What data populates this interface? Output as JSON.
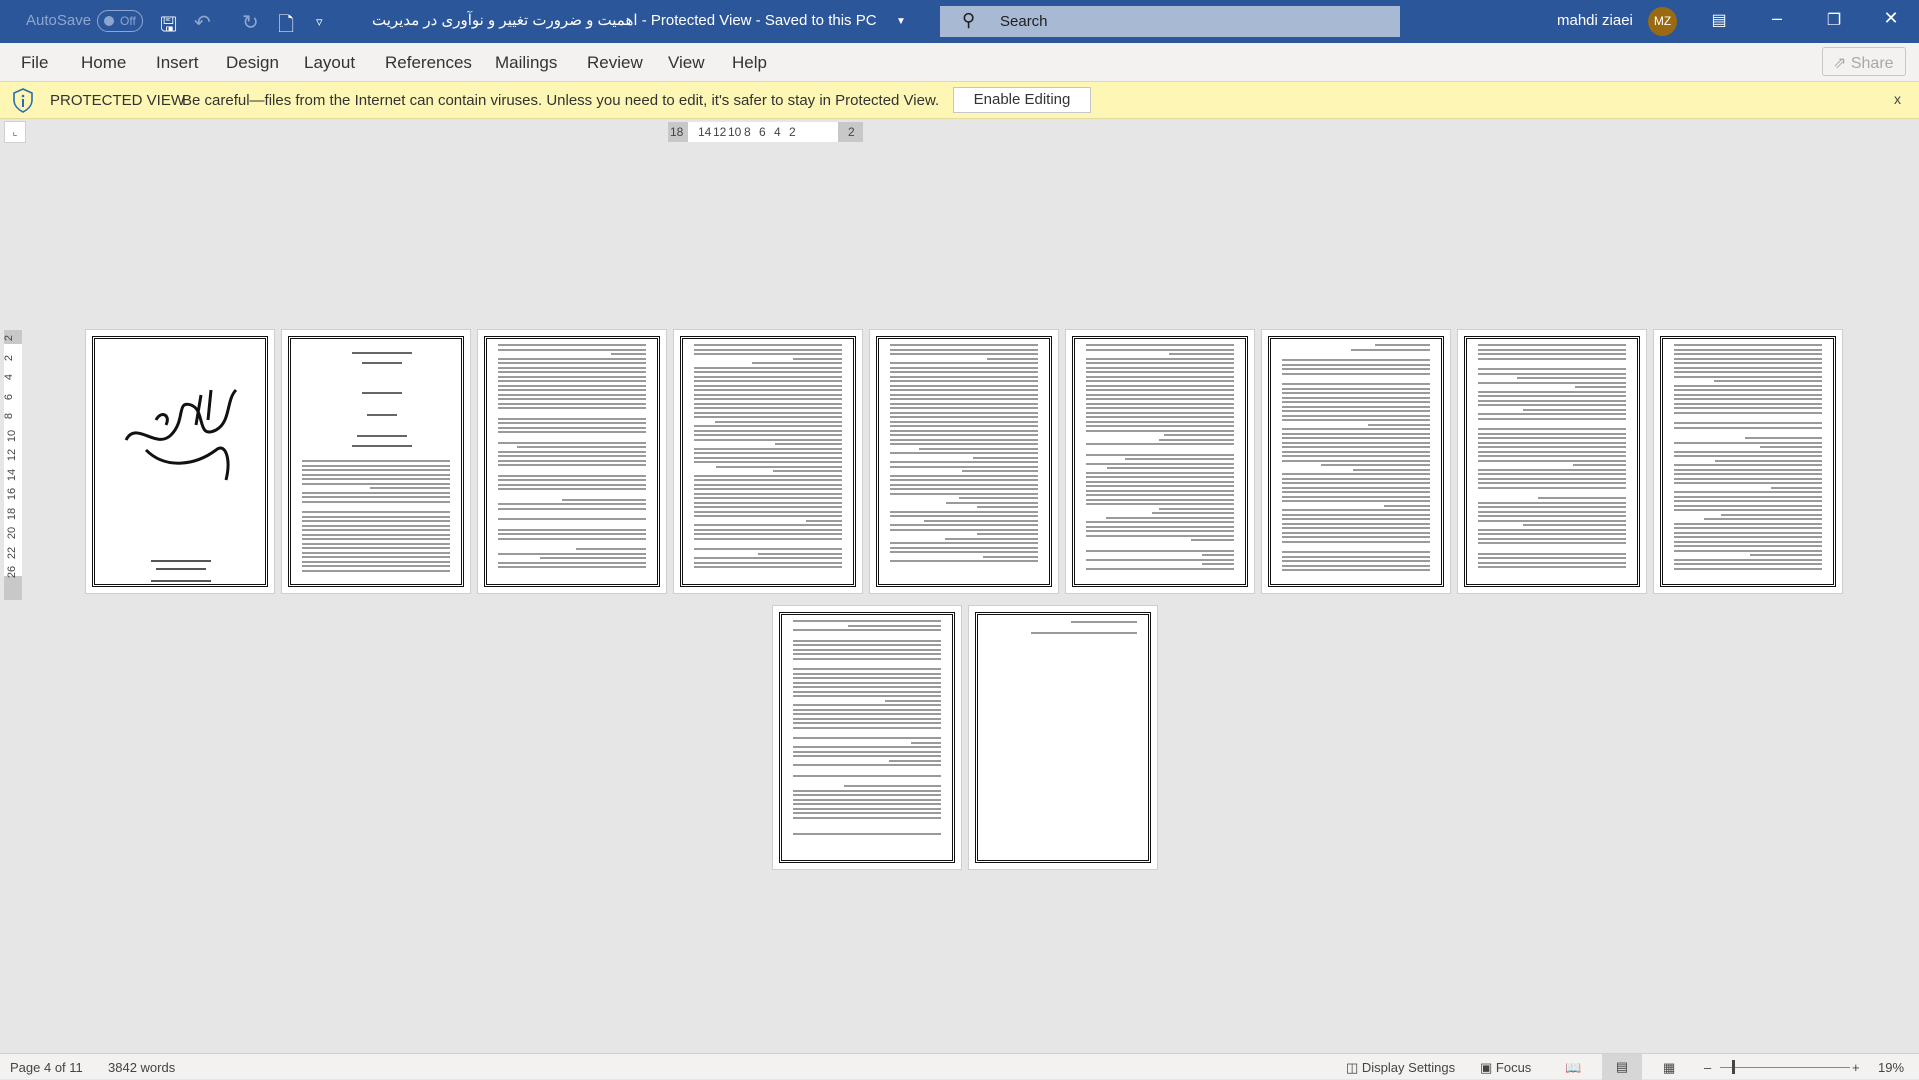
{
  "titlebar": {
    "autosave_label": "AutoSave",
    "autosave_state": "Off",
    "document_title": "اهمیت و ضرورت تغییر و نوآوری در مدیریت  -  Protected View  -  Saved to this PC",
    "search_placeholder": "Search",
    "user_name": "mahdi ziaei",
    "user_initials": "MZ",
    "accent_color": "#2b579a"
  },
  "menu": {
    "items": [
      "File",
      "Home",
      "Insert",
      "Design",
      "Layout",
      "References",
      "Mailings",
      "Review",
      "View",
      "Help"
    ],
    "share_label": "Share"
  },
  "protected_view": {
    "title": "PROTECTED VIEW",
    "message": "Be careful—files from the Internet can contain viruses. Unless you need to edit, it's safer to stay in Protected View.",
    "enable_label": "Enable Editing",
    "close_label": "x",
    "bar_color": "#fdf6b5"
  },
  "ruler": {
    "horizontal_ticks": [
      "18",
      "14",
      "12",
      "10",
      "8",
      "6",
      "4",
      "2",
      "2"
    ],
    "vertical_ticks": [
      "2",
      "2",
      "4",
      "6",
      "8",
      "10",
      "12",
      "14",
      "16",
      "18",
      "20",
      "22",
      "26"
    ]
  },
  "document": {
    "page_count": 11
  },
  "status": {
    "page": "Page 4 of 11",
    "words": "3842 words",
    "display_settings": "Display Settings",
    "focus": "Focus",
    "zoom": "19%",
    "zoom_percent": 19
  }
}
